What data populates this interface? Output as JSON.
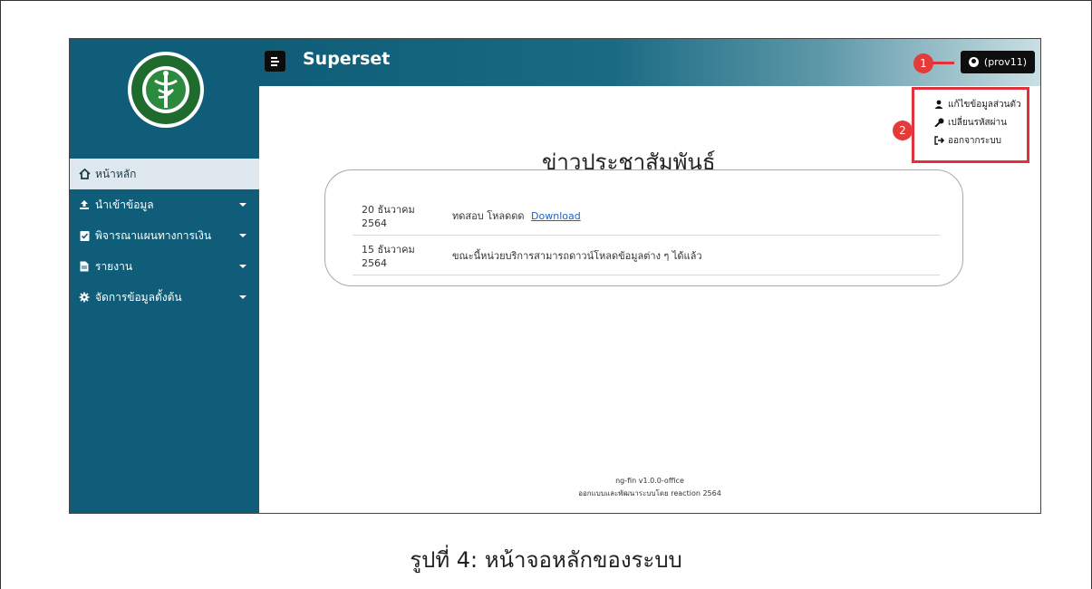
{
  "app": {
    "brand": "Superset",
    "user_label": "(prov11)"
  },
  "sidebar": {
    "items": [
      {
        "label": "หน้าหลัก",
        "icon": "home-icon",
        "active": true,
        "has_caret": false
      },
      {
        "label": "นำเข้าข้อมูล",
        "icon": "upload-icon",
        "active": false,
        "has_caret": true
      },
      {
        "label": "พิจารณาแผนทางการเงิน",
        "icon": "clipboard-check-icon",
        "active": false,
        "has_caret": true
      },
      {
        "label": "รายงาน",
        "icon": "file-icon",
        "active": false,
        "has_caret": true
      },
      {
        "label": "จัดการข้อมูลตั้งต้น",
        "icon": "gear-icon",
        "active": false,
        "has_caret": true
      }
    ]
  },
  "user_menu": {
    "items": [
      {
        "label": "แก้ไขข้อมูลส่วนตัว",
        "icon": "user-icon"
      },
      {
        "label": "เปลี่ยนรหัสผ่าน",
        "icon": "key-icon"
      },
      {
        "label": "ออกจากระบบ",
        "icon": "sign-out-icon"
      }
    ]
  },
  "news": {
    "title": "ข่าวประชาสัมพันธ์",
    "rows": [
      {
        "date": "20 ธันวาคม 2564",
        "text": "ทดสอบ โหลดดด",
        "link": "Download"
      },
      {
        "date": "15 ธันวาคม 2564",
        "text": "ขณะนี้หน่วยบริการสามารถดาวน์โหลดข้อมูลต่าง ๆ ได้แล้ว",
        "link": ""
      }
    ]
  },
  "footer": {
    "version": "ng-fin v1.0.0-office",
    "credit": "ออกแบบและพัฒนาระบบโดย reaction 2564"
  },
  "annotations": {
    "badge_1": "1",
    "badge_2": "2",
    "color": "#e0323a"
  },
  "caption": "รูปที่ 4: หน้าจอหลักของระบบ",
  "colors": {
    "sidebar": "#0f5d78",
    "active_item_bg": "#dfe8ee",
    "link": "#1d63c9"
  }
}
